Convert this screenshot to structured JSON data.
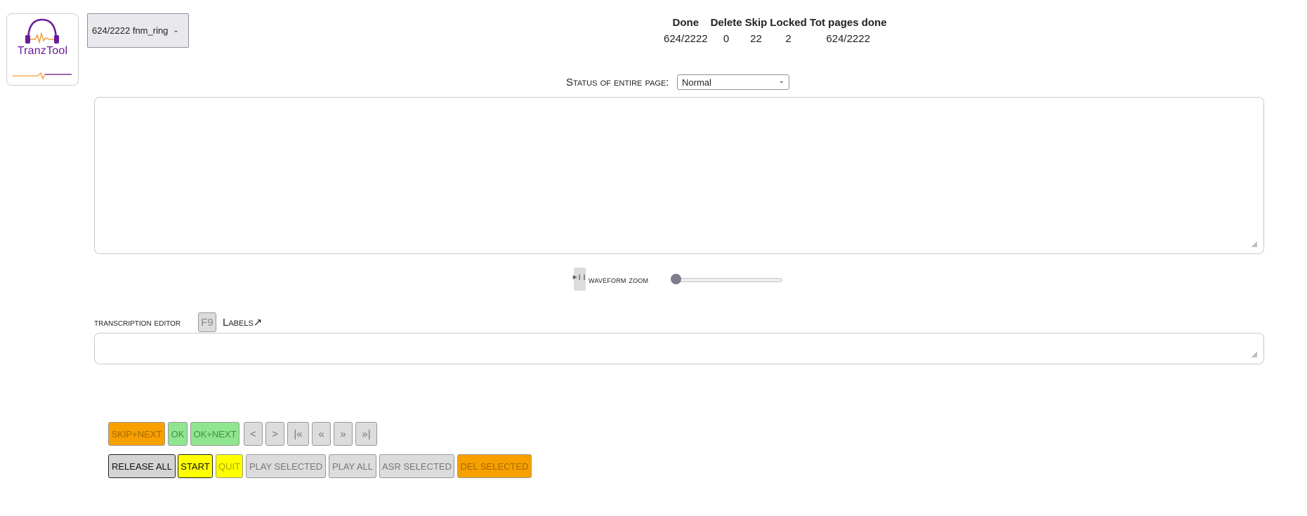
{
  "logo": {
    "text": "TranzTool"
  },
  "page_select": {
    "value": "624/2222 fnm_ring"
  },
  "stats": {
    "headers": [
      "Done",
      "Delete",
      "Skip",
      "Locked",
      "Tot pages done"
    ],
    "values": [
      "624/2222",
      "0",
      "22",
      "2",
      "624/2222"
    ]
  },
  "status": {
    "label": "Status of entire page:",
    "value": "Normal"
  },
  "waveform": {
    "button_icon": "play-pause-icon",
    "label": "waveform zoom",
    "zoom_level": 0
  },
  "editor": {
    "label": "transcription editor",
    "f9": "F9",
    "labels_link": "Labels↗"
  },
  "buttons_row1": [
    {
      "label": "SKIP+NEXT"
    },
    {
      "label": "OK"
    },
    {
      "label": "OK+NEXT"
    },
    {
      "label": "<"
    },
    {
      "label": ">"
    },
    {
      "label": "|«"
    },
    {
      "label": "«"
    },
    {
      "label": "»"
    },
    {
      "label": "»|"
    }
  ],
  "buttons_row2": [
    {
      "label": "RELEASE ALL"
    },
    {
      "label": "START"
    },
    {
      "label": "QUIT"
    },
    {
      "label": "PLAY SELECTED"
    },
    {
      "label": "PLAY ALL"
    },
    {
      "label": "ASR SELECTED"
    },
    {
      "label": "DEL SELECTED"
    }
  ],
  "colors": {
    "orange": "#f7a000",
    "green": "#8fe68f",
    "yellow": "#ffff00",
    "logo_purple": "#6a1b9a",
    "logo_orange": "#f29b3a"
  }
}
